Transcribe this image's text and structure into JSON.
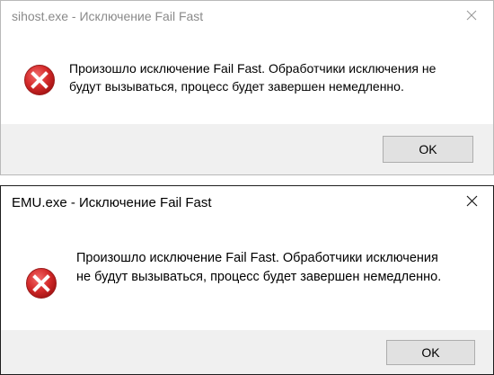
{
  "dialogs": [
    {
      "title": "sihost.exe - Исключение Fail Fast",
      "message": "Произошло исключение Fail Fast. Обработчики исключения не будут вызываться, процесс будет завершен немедленно.",
      "button_label": "OK",
      "icon": "error-icon",
      "active": false
    },
    {
      "title": "EMU.exe - Исключение Fail Fast",
      "message": "Произошло исключение Fail Fast. Обработчики исключения не будут вызываться, процесс будет завершен немедленно.",
      "button_label": "OK",
      "icon": "error-icon",
      "active": true
    }
  ],
  "colors": {
    "error_red": "#d12f2f",
    "footer_bg": "#f0f0f0",
    "button_bg": "#e1e1e1",
    "inactive_title": "#8a8a8a"
  }
}
